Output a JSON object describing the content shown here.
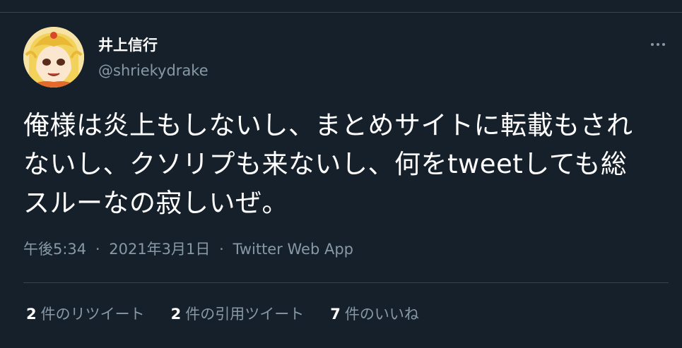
{
  "author": {
    "display_name": "井上信行",
    "handle": "@shriekydrake",
    "avatar_icon": "anime-character-avatar"
  },
  "more_icon": "more-horizontal-icon",
  "tweet": {
    "lines": [
      "俺様は炎上もしないし、まとめサイトに転載もされ",
      "ないし、クソリプも来ないし、何をtweetしても総",
      "スルーなの寂しいぜ。"
    ]
  },
  "meta": {
    "time": "午後5:34",
    "separator": "·",
    "date": "2021年3月1日",
    "source": "Twitter Web App"
  },
  "stats": {
    "retweets": {
      "count": "2",
      "label": "件のリツイート"
    },
    "quotes": {
      "count": "2",
      "label": "件の引用ツイート"
    },
    "likes": {
      "count": "7",
      "label": "件のいいね"
    }
  },
  "colors": {
    "background": "#15202b",
    "primary_text": "#ffffff",
    "secondary_text": "#8899a6",
    "divider": "#38444d"
  }
}
